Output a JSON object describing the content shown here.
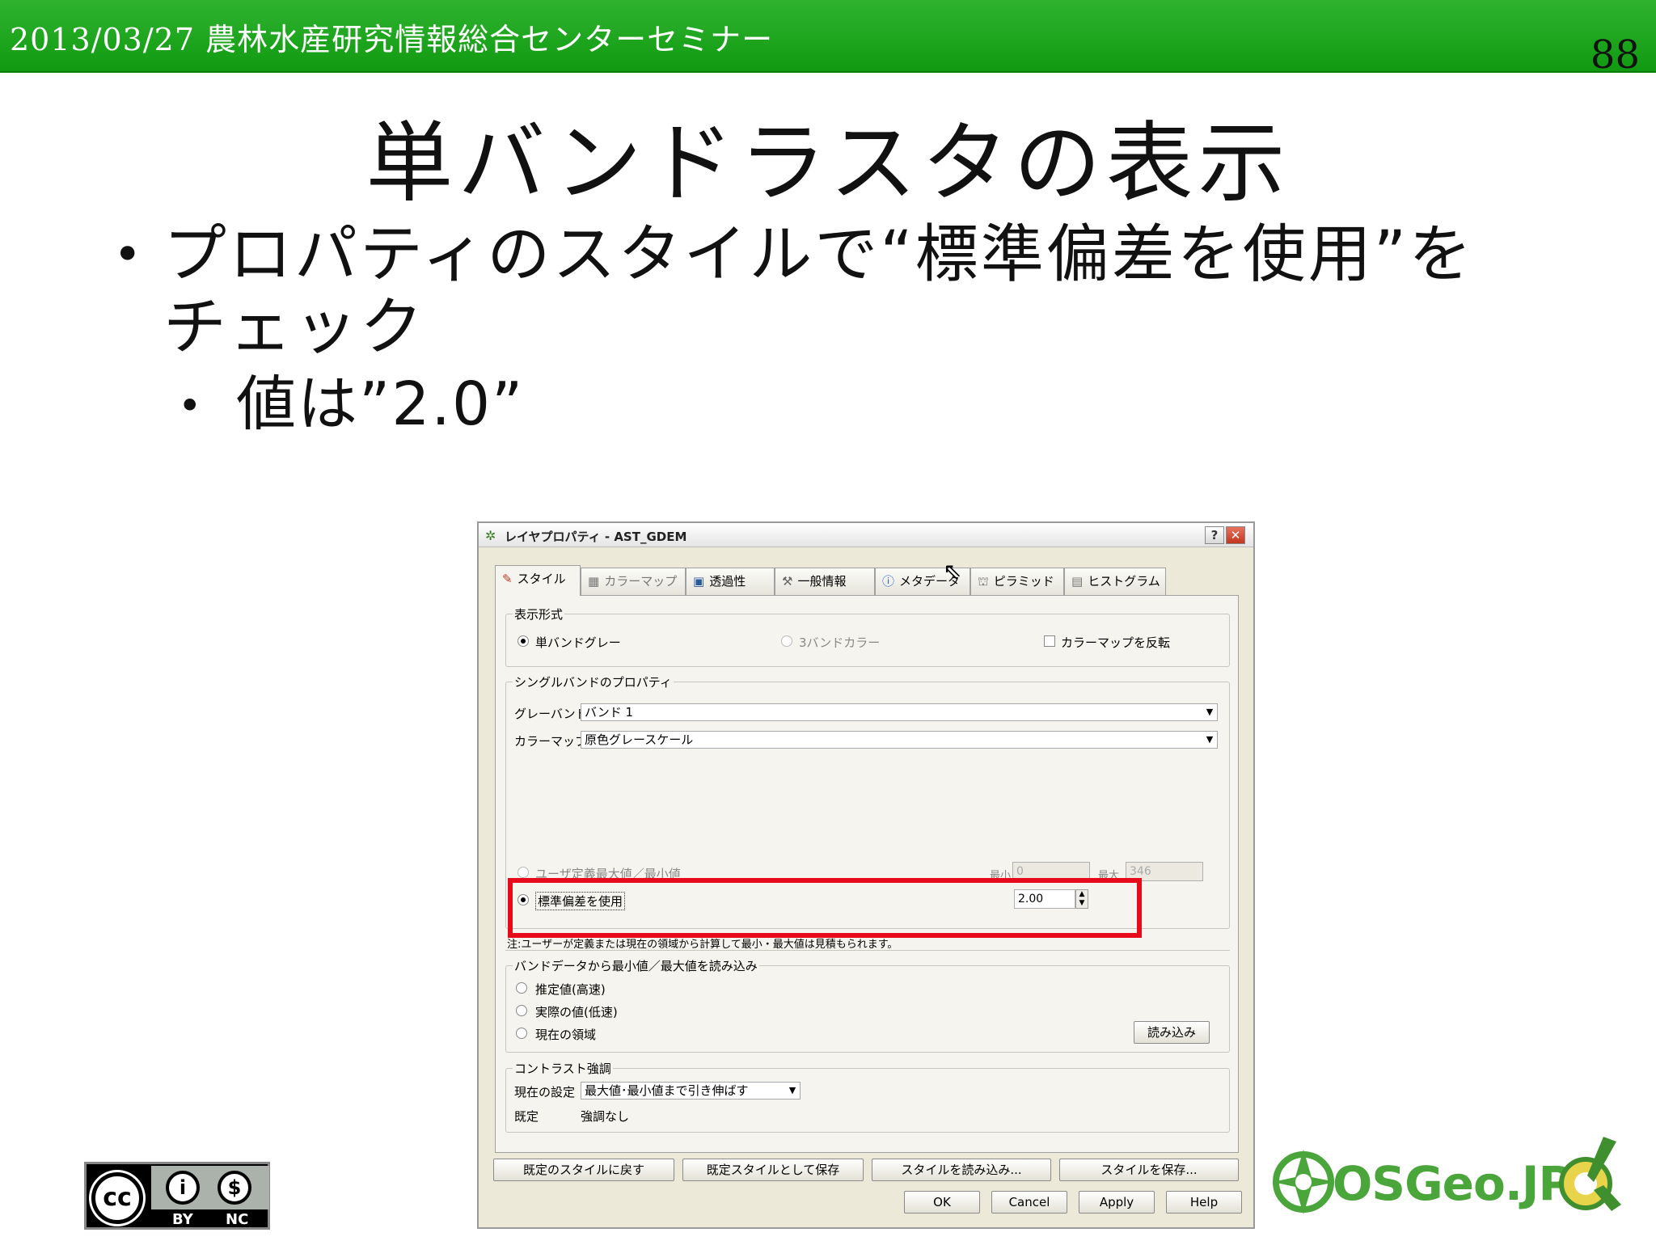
{
  "slide": {
    "header": "2013/03/27 農林水産研究情報総合センターセミナー",
    "page_number": "88",
    "title": "単バンドラスタの表示",
    "bullet1": "プロパティのスタイルで“標準偏差を使用”をチェック",
    "bullet2": "値は”2.0”",
    "cc_labels": {
      "by": "BY",
      "nc": "NC"
    },
    "logo_text": "OSGeo.JP"
  },
  "dialog": {
    "title": "レイヤプロパティ - AST_GDEM",
    "help_btn": "?",
    "close_btn": "✕",
    "tabs": [
      {
        "label": "スタイル",
        "icon": "brush-icon"
      },
      {
        "label": "カラーマップ",
        "icon": "colormap-icon"
      },
      {
        "label": "透過性",
        "icon": "transparency-icon"
      },
      {
        "label": "一般情報",
        "icon": "tools-icon"
      },
      {
        "label": "メタデータ",
        "icon": "info-icon"
      },
      {
        "label": "ピラミッド",
        "icon": "pyramid-icon"
      },
      {
        "label": "ヒストグラム",
        "icon": "histogram-icon"
      }
    ],
    "display_group": {
      "label": "表示形式",
      "single_gray": "単バンドグレー",
      "three_band": "3バンドカラー",
      "invert": "カラーマップを反転"
    },
    "single_band_group": {
      "label": "シングルバンドのプロパティ",
      "gray_band_label": "グレーバンド",
      "gray_band_value": "バンド 1",
      "colormap_label": "カラーマップ",
      "colormap_value": "原色グレースケール",
      "user_minmax": "ユーザ定義最大値／最小値",
      "min_label": "最小",
      "min_value": "0",
      "max_label": "最大",
      "max_value": "346",
      "stddev_label": "標準偏差を使用",
      "stddev_value": "2.00"
    },
    "note": "注:ユーザーが定義または現在の領域から計算して最小・最大値は見積もられます。",
    "load_group": {
      "label": "バンドデータから最小値／最大値を読み込み",
      "estimate": "推定値(高速)",
      "actual": "実際の値(低速)",
      "current_extent": "現在の領域",
      "load_btn": "読み込み"
    },
    "contrast_group": {
      "label": "コントラスト強調",
      "current_label": "現在の設定",
      "current_value": "最大値･最小値まで引き伸ばす",
      "default_label": "既定",
      "default_value": "強調なし"
    },
    "style_buttons": {
      "restore": "既定のスタイルに戻す",
      "save_default": "既定スタイルとして保存",
      "load_style": "スタイルを読み込み...",
      "save_style": "スタイルを保存..."
    },
    "buttons": {
      "ok": "OK",
      "cancel": "Cancel",
      "apply": "Apply",
      "help": "Help"
    }
  }
}
